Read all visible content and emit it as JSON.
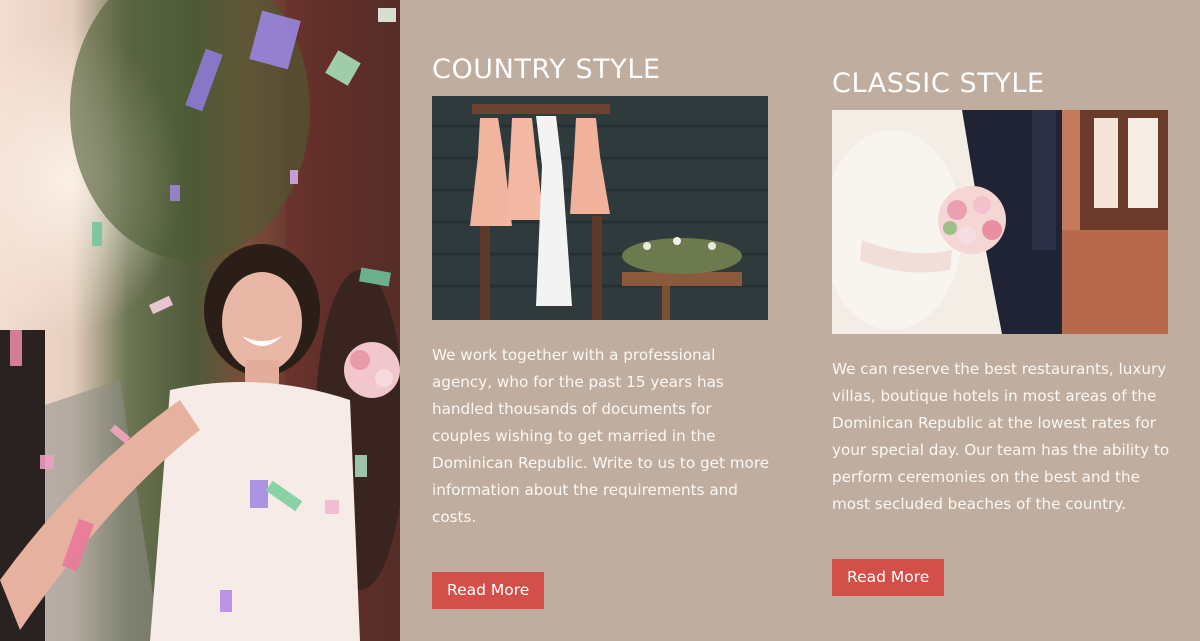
{
  "hero": {
    "image": "wedding-bride-confetti-photo"
  },
  "sections": [
    {
      "title": "COUNTRY STYLE",
      "image": "bridesmaid-dresses-hanging-photo",
      "description": "We work together with a professional agency, who for the past 15 years has handled thousands of documents for couples wishing to get married in the Dominican Republic.  Write to us to get more information about the requirements and costs.",
      "button_label": "Read More"
    },
    {
      "title": "CLASSIC STYLE",
      "image": "bride-groom-bouquet-photo",
      "description": "We can reserve the best restaurants, luxury villas, boutique hotels in most areas of the Dominican Republic at the lowest rates for your special day. Our team has the ability to perform ceremonies on the best and the most secluded beaches of the country.",
      "button_label": "Read More"
    }
  ],
  "colors": {
    "background": "#bfad9f",
    "button": "#d34f4a",
    "text": "#ffffff"
  }
}
